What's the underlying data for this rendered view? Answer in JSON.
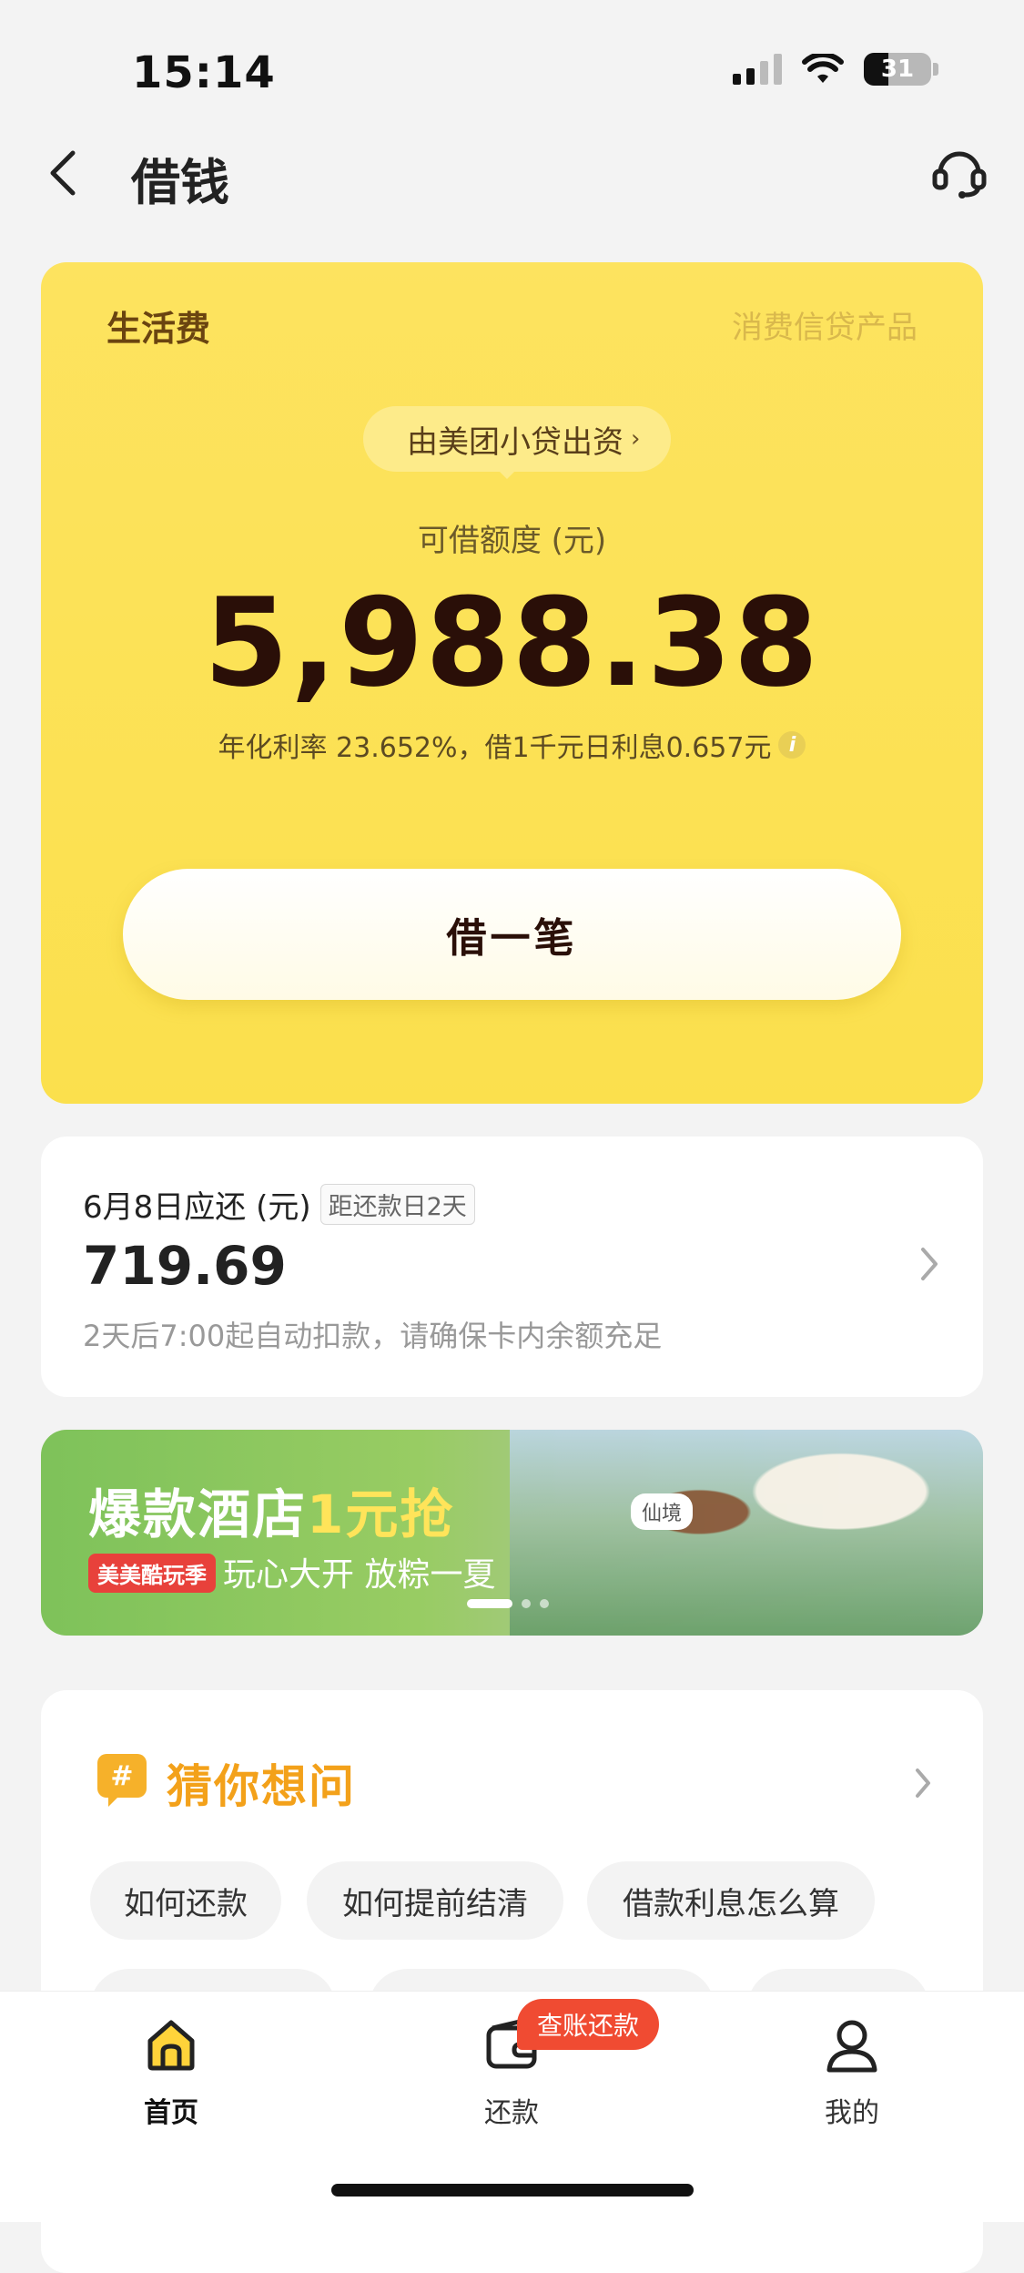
{
  "status_bar": {
    "time": "15:14",
    "battery": "31"
  },
  "nav": {
    "title": "借钱"
  },
  "credit_card": {
    "label": "生活费",
    "product_type": "消费信贷产品",
    "lender": "由美团小贷出资",
    "limit_label": "可借额度 (元)",
    "limit_amount": "5,988.38",
    "rate_text": "年化利率 23.652%，借1千元日利息0.657元",
    "borrow_button": "借一笔"
  },
  "repayment": {
    "title": "6月8日应还 (元)",
    "due_badge": "距还款日2天",
    "amount": "719.69",
    "note": "2天后7:00起自动扣款，请确保卡内余额充足"
  },
  "banner": {
    "headline_prefix": "爆款酒店",
    "headline_highlight": "1元抢",
    "tag": "美美酷玩季",
    "subtitle": "玩心大开 放粽一夏",
    "scene_badge": "仙境"
  },
  "guess": {
    "title": "猜你想问",
    "chips": [
      "如何还款",
      "如何提前结清",
      "借款利息怎么算"
    ]
  },
  "tab_bar": {
    "home": "首页",
    "repay": "还款",
    "mine": "我的",
    "repay_badge": "查账还款"
  },
  "colors": {
    "card_yellow": "#fbe04d",
    "amount_dark": "#2a0f08",
    "accent_orange": "#f3a11a",
    "badge_red": "#f04b32"
  }
}
